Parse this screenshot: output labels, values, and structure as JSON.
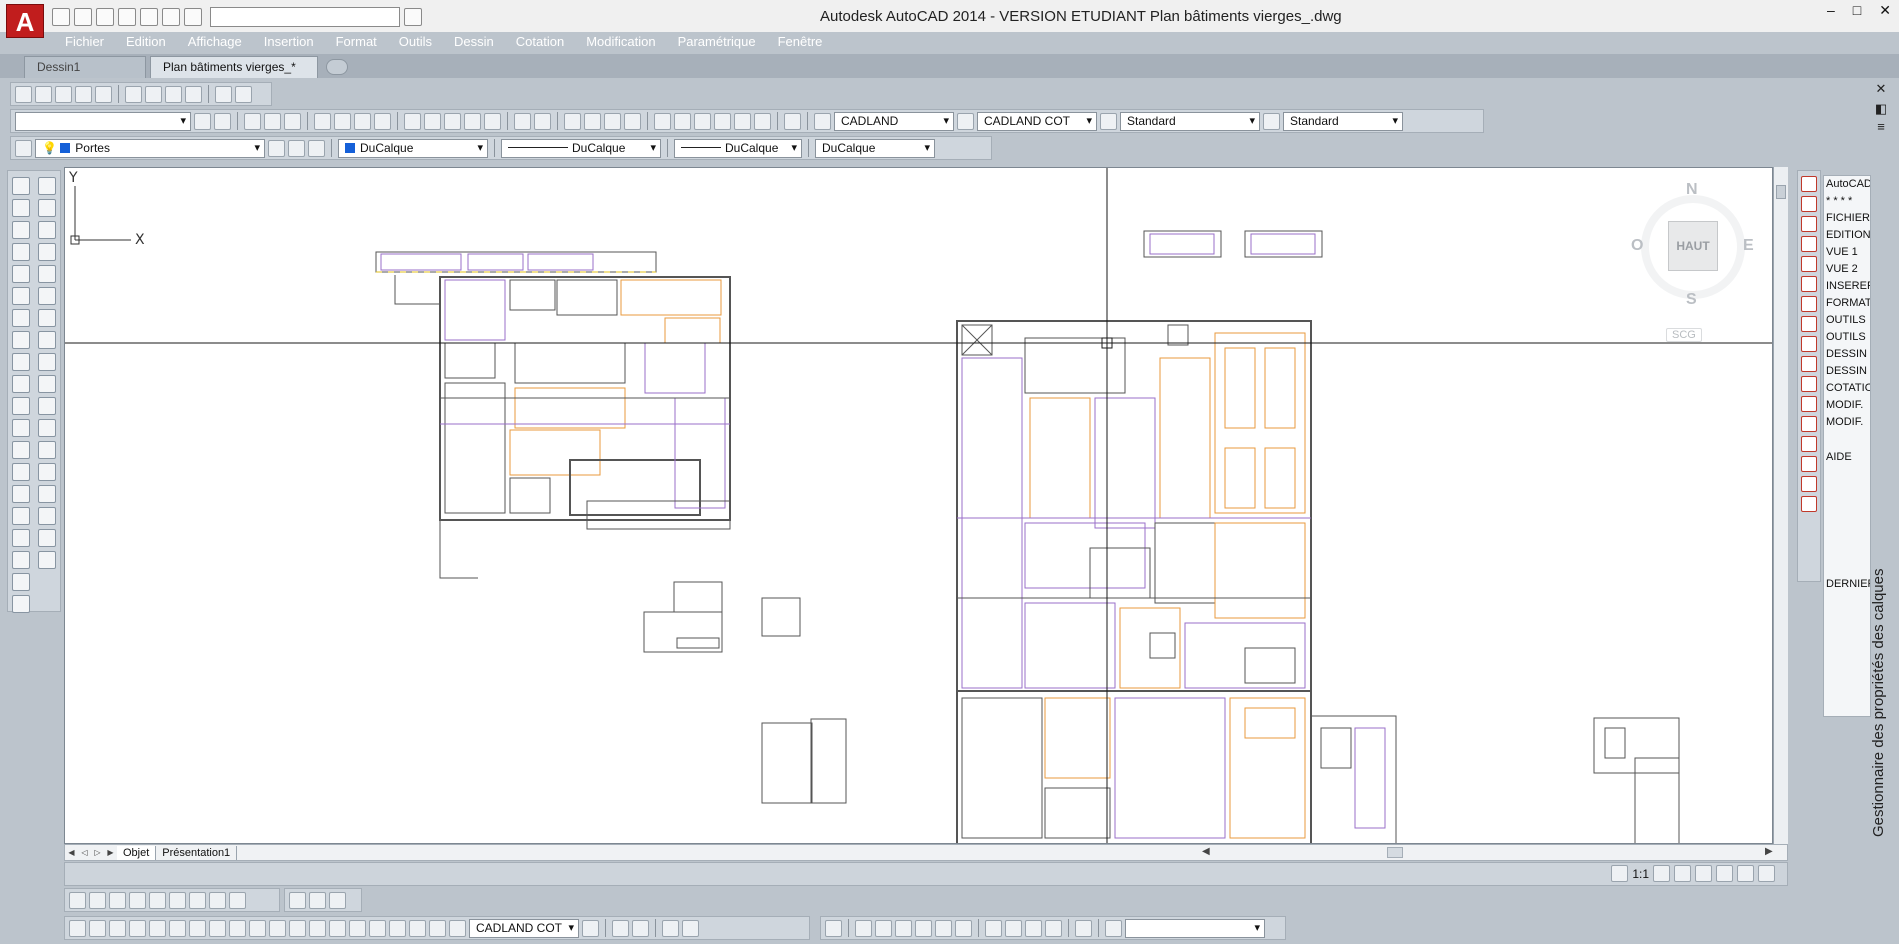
{
  "titlebar": {
    "app_logo": "A",
    "window_title": "Autodesk AutoCAD 2014 - VERSION ETUDIANT      Plan bâtiments vierges_.dwg",
    "minimize": "–",
    "maximize": "□",
    "close": "✕"
  },
  "menu": [
    "Fichier",
    "Edition",
    "Affichage",
    "Insertion",
    "Format",
    "Outils",
    "Dessin",
    "Cotation",
    "Modification",
    "Paramétrique",
    "Fenêtre"
  ],
  "file_tabs": [
    {
      "label": "Dessin1"
    },
    {
      "label": "Plan bâtiments vierges_*",
      "close": "✕"
    }
  ],
  "toolbars": {
    "text_style": "CADLAND",
    "dim_style": "CADLAND COT",
    "table_style": "Standard",
    "multileader_style": "Standard",
    "layer": "Portes",
    "color": "DuCalque",
    "linetype": "DuCalque",
    "lineweight": "DuCalque",
    "plot_style": "DuCalque",
    "bottom_dim_style": "CADLAND COT"
  },
  "viewcube": {
    "north": "N",
    "south": "S",
    "east": "E",
    "west": "O",
    "face": "HAUT",
    "ucs_menu": "SCG"
  },
  "ucs_icon": {
    "x_label": "X",
    "y_label": "Y"
  },
  "layout_tabs": [
    "Objet",
    "Présentation1"
  ],
  "status": {
    "scale": "1:1"
  },
  "menu_panel": {
    "items": [
      "AutoCAD",
      "* * * *",
      "FICHIER",
      "EDITION",
      "VUE 1",
      "VUE 2",
      "INSERER",
      "FORMAT",
      "OUTILS",
      "OUTILS",
      "DESSIN",
      "DESSIN",
      "COTATION",
      "MODIF.",
      "MODIF."
    ],
    "help": "AIDE",
    "last": "DERNIER"
  },
  "side_panel": {
    "title": "Gestionnaire des propriétés des calques",
    "close": "✕"
  }
}
